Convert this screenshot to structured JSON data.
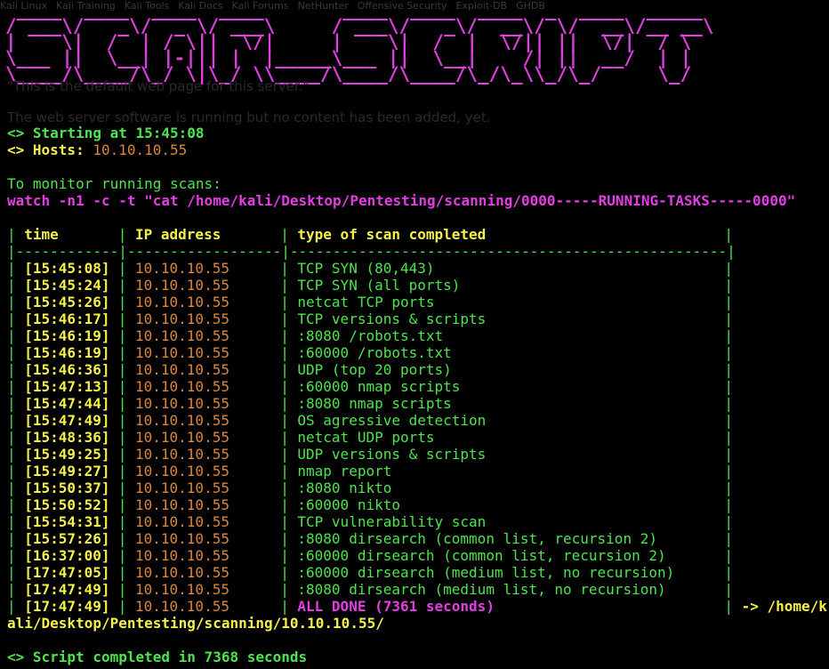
{
  "bookmarks": [
    "Kali Linux",
    "Kali Training",
    "Kali Tools",
    "Kali Docs",
    "Kali Forums",
    "NetHunter",
    "Offensive Security",
    "Exploit-DB",
    "GHDB"
  ],
  "banner": {
    "title": "scan_script",
    "art": [
      " ____  ____  ____  ____       ____  ____  ____  _  ____  _____",
      "/ ___\\/   _\\/  _ \\/ ___\\     / ___\\/   _\\/  __\\/ \\/  __\\/__ __\\",
      "|    \\|  /  | / \\||  \\/|     |    \\|  /  |  \\/|| ||  \\/|  / \\",
      "\\___ ||  \\__| |-||| |  |_____\\___ ||  \\__|    /| ||  __/  | |",
      "\\____/\\____/\\_/ \\|\\_/ \\\\____/\\____/\\____/\\_/\\_\\\\_/\\_/     \\_/"
    ],
    "subtitle": "\"This is the default web page for this server.\"",
    "note": "The web server software is running but no content has been added, yet."
  },
  "status": {
    "starting_label": "<> Starting at 15:45:08",
    "hosts_label": "<> Hosts: ",
    "hosts_value": "10.10.10.55"
  },
  "monitor": {
    "label": "To monitor running scans:",
    "command": "watch -n1 -c -t \"cat /home/kali/Desktop/Pentesting/scanning/0000-----RUNNING-TASKS-----0000\""
  },
  "table": {
    "headers": [
      "time",
      "IP address",
      "type of scan completed"
    ],
    "rows": [
      {
        "time": "[15:45:08]",
        "ip": "10.10.10.55",
        "scan": "TCP SYN (80,443)"
      },
      {
        "time": "[15:45:24]",
        "ip": "10.10.10.55",
        "scan": "TCP SYN (all ports)"
      },
      {
        "time": "[15:45:26]",
        "ip": "10.10.10.55",
        "scan": "netcat TCP ports"
      },
      {
        "time": "[15:46:17]",
        "ip": "10.10.10.55",
        "scan": "TCP versions & scripts"
      },
      {
        "time": "[15:46:19]",
        "ip": "10.10.10.55",
        "scan": ":8080 /robots.txt"
      },
      {
        "time": "[15:46:19]",
        "ip": "10.10.10.55",
        "scan": ":60000 /robots.txt"
      },
      {
        "time": "[15:46:36]",
        "ip": "10.10.10.55",
        "scan": "UDP (top 20 ports)"
      },
      {
        "time": "[15:47:13]",
        "ip": "10.10.10.55",
        "scan": ":60000 nmap scripts"
      },
      {
        "time": "[15:47:44]",
        "ip": "10.10.10.55",
        "scan": ":8080 nmap scripts"
      },
      {
        "time": "[15:47:49]",
        "ip": "10.10.10.55",
        "scan": "OS agressive detection"
      },
      {
        "time": "[15:48:36]",
        "ip": "10.10.10.55",
        "scan": "netcat UDP ports"
      },
      {
        "time": "[15:49:25]",
        "ip": "10.10.10.55",
        "scan": "UDP versions & scripts"
      },
      {
        "time": "[15:49:27]",
        "ip": "10.10.10.55",
        "scan": "nmap report"
      },
      {
        "time": "[15:50:37]",
        "ip": "10.10.10.55",
        "scan": ":8080 nikto"
      },
      {
        "time": "[15:50:52]",
        "ip": "10.10.10.55",
        "scan": ":60000 nikto"
      },
      {
        "time": "[15:54:31]",
        "ip": "10.10.10.55",
        "scan": "TCP vulnerability scan"
      },
      {
        "time": "[15:57:26]",
        "ip": "10.10.10.55",
        "scan": ":8080 dirsearch (common list, recursion 2)"
      },
      {
        "time": "[16:37:00]",
        "ip": "10.10.10.55",
        "scan": ":60000 dirsearch (common list, recursion 2)"
      },
      {
        "time": "[17:47:05]",
        "ip": "10.10.10.55",
        "scan": ":60000 dirsearch (medium list, no recursion)"
      },
      {
        "time": "[17:47:49]",
        "ip": "10.10.10.55",
        "scan": ":8080 dirsearch (medium list, no recursion)"
      }
    ],
    "final_row": {
      "time": "[17:47:49]",
      "ip": "10.10.10.55",
      "scan": "ALL DONE (7361 seconds)",
      "path_start": "-> /home/k",
      "path_rest": "ali/Desktop/Pentesting/scanning/10.10.10.55/"
    }
  },
  "footer": {
    "completed": "<> Script completed in 7368 seconds"
  },
  "colors": {
    "background": "#000000",
    "green": "#4ee44e",
    "yellow": "#f5f04a",
    "orange": "#d9873a",
    "magenta": "#e23ee2",
    "banner": "#e040e0"
  }
}
